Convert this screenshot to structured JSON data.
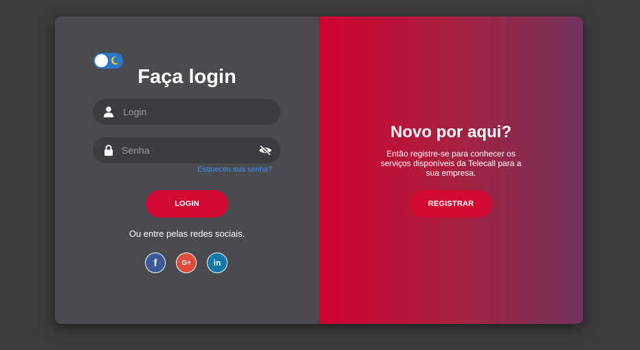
{
  "login": {
    "title": "Faça login",
    "login_placeholder": "Login",
    "password_placeholder": "Senha",
    "forgot_password": "Esqueceu sua senha?",
    "login_button": "LOGIN",
    "social_text": "Ou entre pelas redes sociais.",
    "social": [
      {
        "name": "facebook",
        "glyph": "f"
      },
      {
        "name": "google-plus",
        "glyph": "G+"
      },
      {
        "name": "linkedin",
        "glyph": "in"
      }
    ]
  },
  "register": {
    "title": "Novo por aqui?",
    "description": "Então registre-se para conhecer os serviços disponíveis da Telecall para a sua empresa.",
    "register_button": "REGISTRAR"
  },
  "theme_toggle": {
    "state": "dark",
    "icon": "moon-icon"
  },
  "colors": {
    "accent": "#d20b35",
    "toggle": "#2b77c9",
    "link": "#3f8ff0",
    "panel": "#4a4b50",
    "gradient_start": "#d0022e",
    "gradient_end": "#72345b"
  }
}
